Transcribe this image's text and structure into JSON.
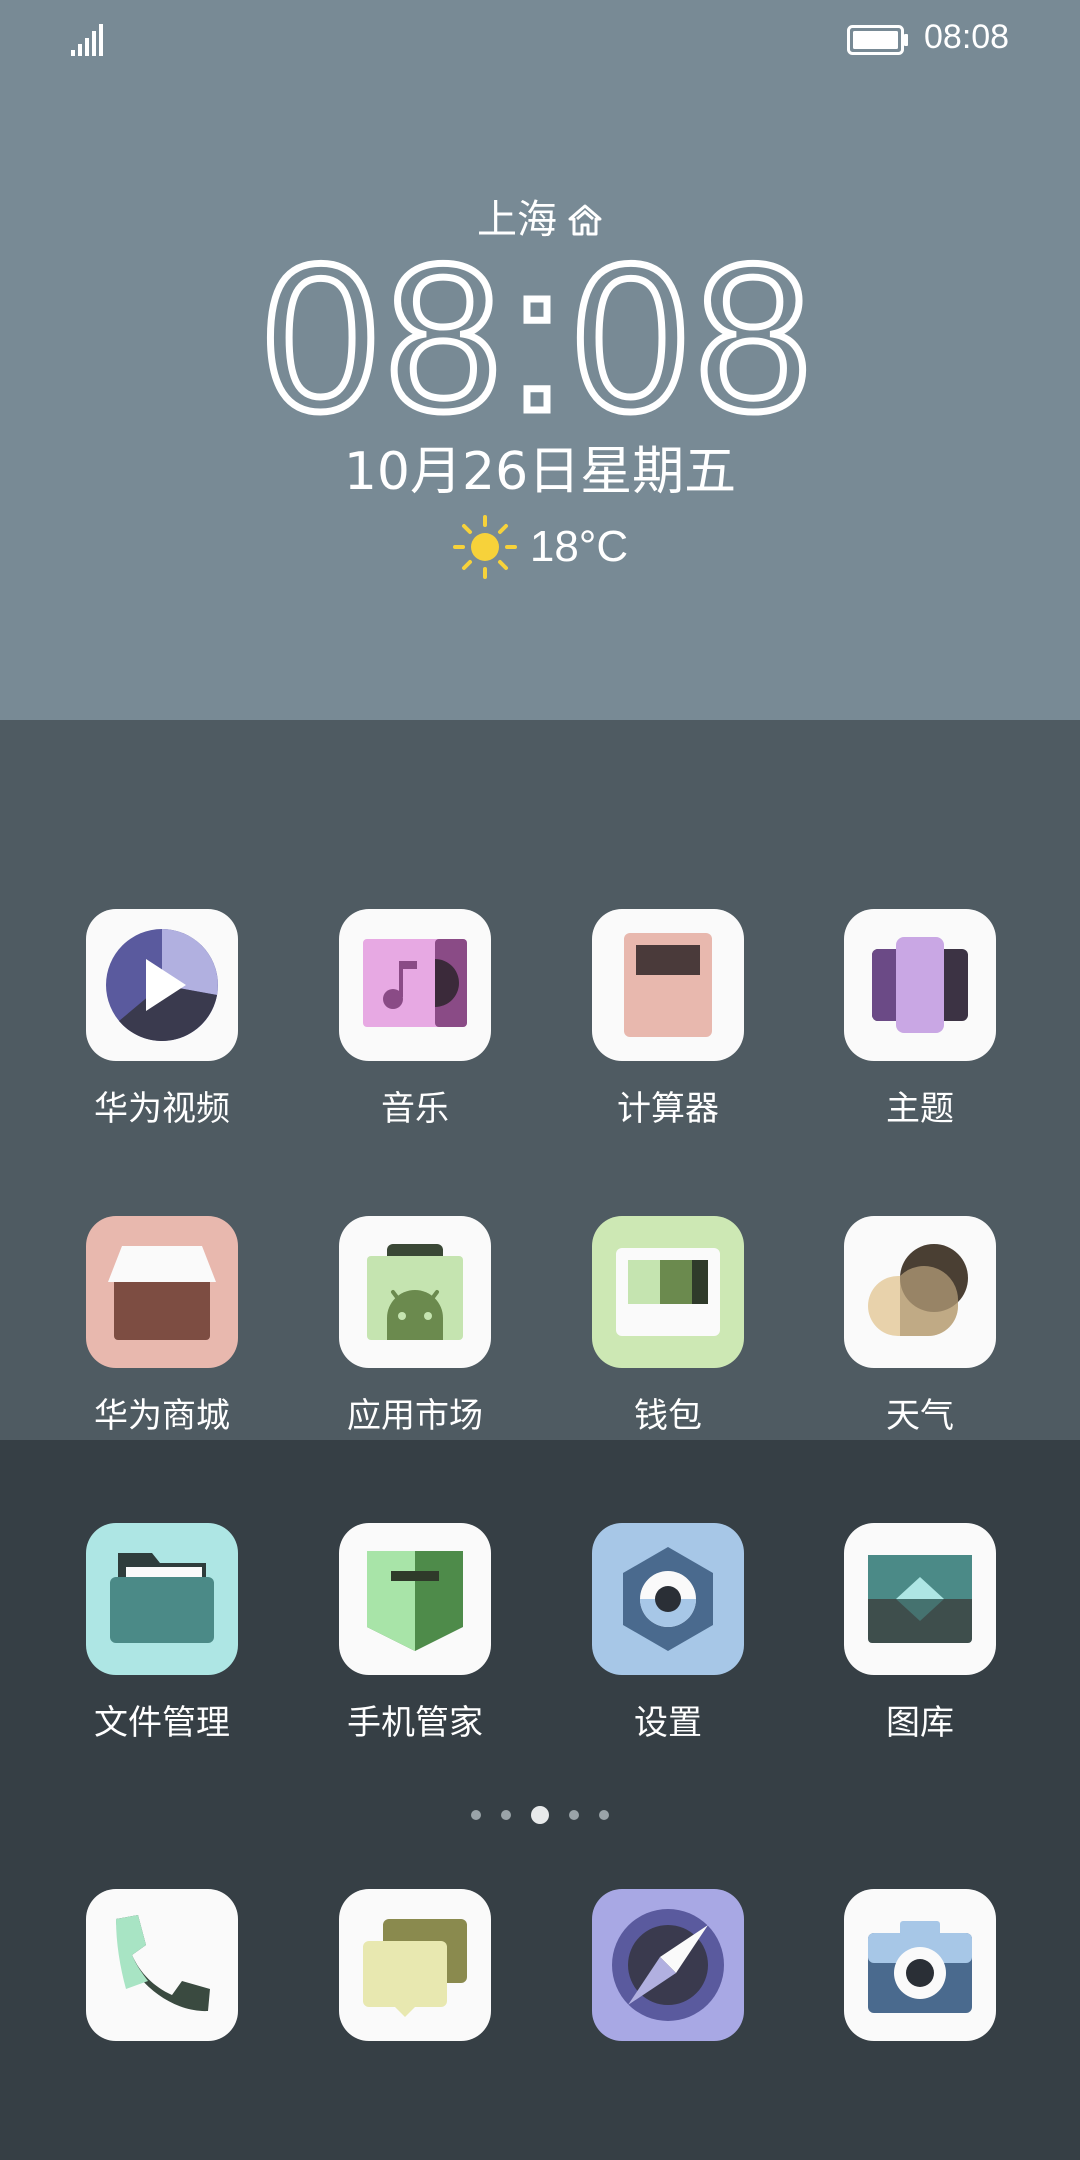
{
  "status_bar": {
    "time": "08:08",
    "signal_icon": "signal-strength-icon",
    "battery_icon": "battery-full-icon"
  },
  "clock_widget": {
    "city": "上海",
    "home_icon": "home-icon",
    "time": "08:08",
    "date": "10月26日星期五",
    "weather_icon": "sun-icon",
    "temperature": "18°C"
  },
  "apps": [
    {
      "label": "华为视频",
      "icon": "video-icon"
    },
    {
      "label": "音乐",
      "icon": "music-icon"
    },
    {
      "label": "计算器",
      "icon": "calculator-icon"
    },
    {
      "label": "主题",
      "icon": "themes-icon"
    },
    {
      "label": "华为商城",
      "icon": "store-icon"
    },
    {
      "label": "应用市场",
      "icon": "app-market-icon"
    },
    {
      "label": "钱包",
      "icon": "wallet-icon"
    },
    {
      "label": "天气",
      "icon": "weather-icon"
    },
    {
      "label": "文件管理",
      "icon": "folder-icon"
    },
    {
      "label": "手机管家",
      "icon": "phone-manager-icon"
    },
    {
      "label": "设置",
      "icon": "settings-icon"
    },
    {
      "label": "图库",
      "icon": "gallery-icon"
    }
  ],
  "page_indicator": {
    "count": 5,
    "active_index": 2
  },
  "dock": [
    {
      "icon": "phone-icon"
    },
    {
      "icon": "messages-icon"
    },
    {
      "icon": "browser-compass-icon"
    },
    {
      "icon": "camera-icon"
    }
  ],
  "colors": {
    "band_top": "#788a95",
    "band_middle": "#4f5b62",
    "band_bottom": "#363f45"
  }
}
